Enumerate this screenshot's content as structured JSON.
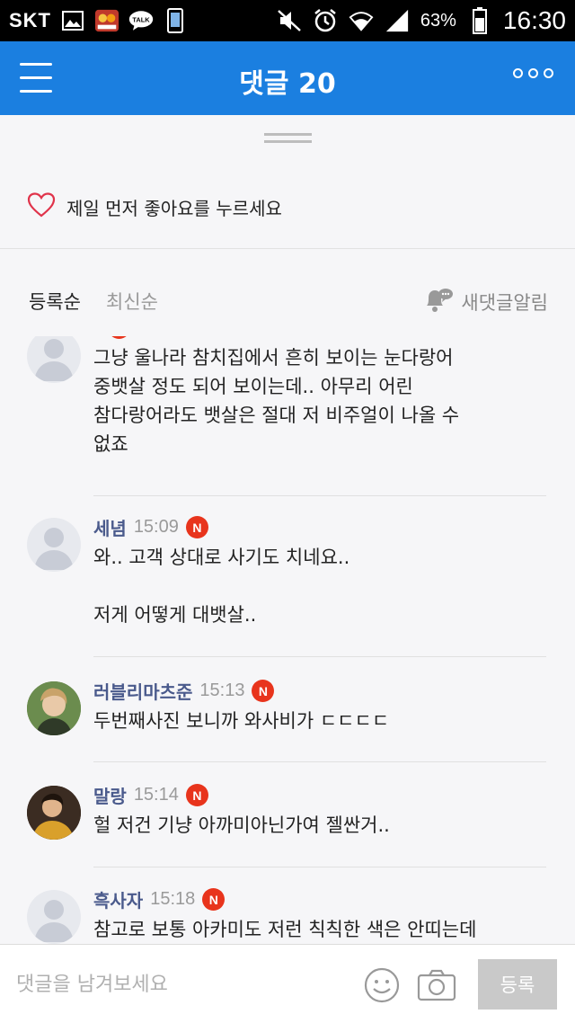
{
  "status_bar": {
    "carrier": "SKT",
    "battery": "63%",
    "time": "16:30",
    "icons": [
      "image-icon",
      "game-app-icon",
      "talk-icon",
      "phone-icon",
      "mute-icon",
      "alarm-icon",
      "wifi-icon",
      "signal-icon",
      "battery-icon"
    ]
  },
  "app_bar": {
    "title": "댓글 20"
  },
  "like": {
    "text": "제일 먼저 좋아요를 누르세요"
  },
  "sort": {
    "registered": "등록순",
    "latest": "최신순",
    "notify": "새댓글알림"
  },
  "comments": [
    {
      "author": "",
      "time": "",
      "badge": "N",
      "body": "그냥 울나라 참치집에서 흔히 보이는 눈다랑어\n중뱃살 정도 되어 보이는데.. 아무리 어린\n참다랑어라도 뱃살은 절대 저 비주얼이 나올 수\n없죠"
    },
    {
      "author": "세념",
      "time": "15:09",
      "badge": "N",
      "body": "와.. 고객 상대로 사기도 치네요..\n\n저게 어떻게 대뱃살.."
    },
    {
      "author": "러블리마츠준",
      "time": "15:13",
      "badge": "N",
      "body": "두번째사진 보니까 와사비가 ㄷㄷㄷㄷ"
    },
    {
      "author": "말랑",
      "time": "15:14",
      "badge": "N",
      "body": "헐 저건 기냥 아까미아닌가여 젤싼거.."
    },
    {
      "author": "흑사자",
      "time": "15:18",
      "badge": "N",
      "body": "참고로 보통 아카미도 저런 칙칙한 색은 안띠는데"
    }
  ],
  "bottom": {
    "placeholder": "댓글을 남겨보세요",
    "submit": "등록"
  },
  "colors": {
    "app_bar": "#1b7fe0",
    "author": "#4a5a8c",
    "badge": "#e8341c",
    "heart": "#e0334a"
  }
}
